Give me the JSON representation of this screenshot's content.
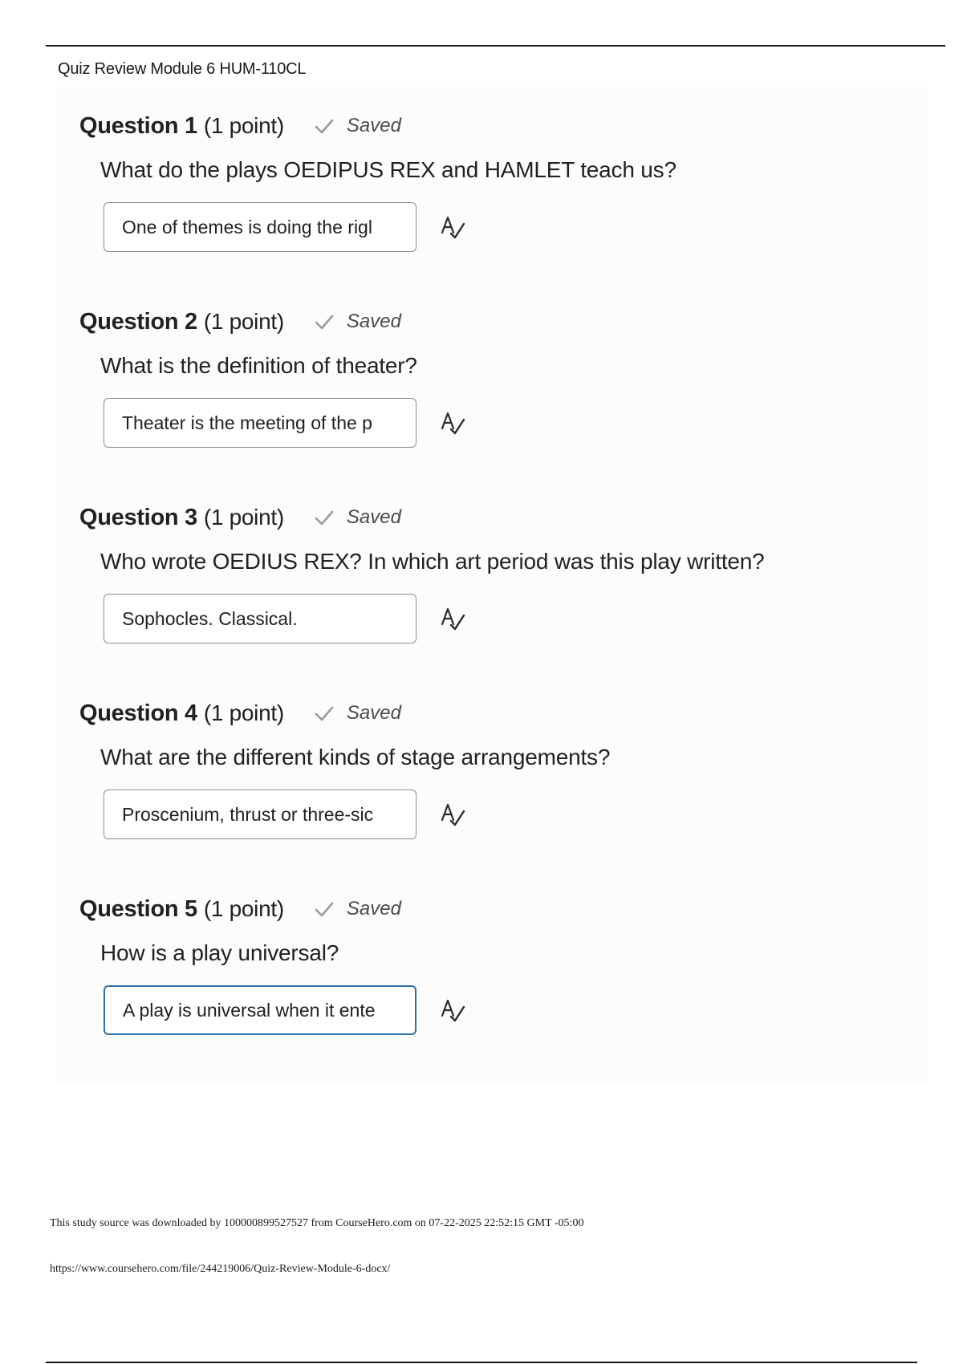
{
  "document": {
    "title": "Quiz Review Module 6 HUM-110CL"
  },
  "questions": [
    {
      "title": "Question 1",
      "points": "(1 point)",
      "status": "Saved",
      "prompt": "What do the plays OEDIPUS REX and HAMLET teach us?",
      "answer": "One of themes is doing the rigl",
      "focused": false
    },
    {
      "title": "Question 2",
      "points": "(1 point)",
      "status": "Saved",
      "prompt": "What is the definition of theater?",
      "answer": "Theater is the meeting of the p",
      "focused": false
    },
    {
      "title": "Question 3",
      "points": "(1 point)",
      "status": "Saved",
      "prompt": "Who wrote OEDIUS REX? In which art period was this play written?",
      "answer": "Sophocles. Classical.",
      "focused": false
    },
    {
      "title": "Question 4",
      "points": "(1 point)",
      "status": "Saved",
      "prompt": "What are the different kinds of stage arrangements?",
      "answer": "Proscenium, thrust or three-sic",
      "focused": false
    },
    {
      "title": "Question 5",
      "points": "(1 point)",
      "status": "Saved",
      "prompt": "How is a play universal?",
      "answer": "A play is universal when it ente",
      "focused": true
    }
  ],
  "icons": {
    "status": "check-icon",
    "spellcheck": "spellcheck-icon"
  },
  "colors": {
    "focus_border": "#2f6fa8",
    "check": "#9a9a9a"
  },
  "footer": {
    "download_note": "This study source was downloaded by 100000899527527 from CourseHero.com on 07-22-2025 22:52:15 GMT -05:00",
    "url": "https://www.coursehero.com/file/244219006/Quiz-Review-Module-6-docx/"
  }
}
